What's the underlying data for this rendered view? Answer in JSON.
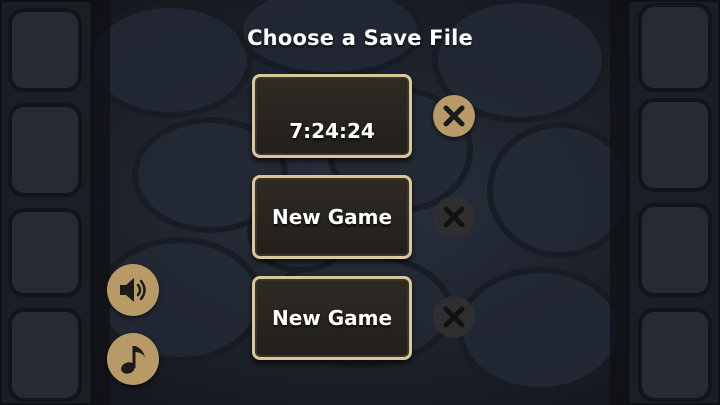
{
  "screen": {
    "title": "Choose a Save File"
  },
  "save_slots": [
    {
      "label": "7:24:24",
      "delete_icon": "x-circle-icon",
      "delete_enabled": true
    },
    {
      "label": "New Game",
      "delete_icon": "x-circle-icon",
      "delete_enabled": false
    },
    {
      "label": "New Game",
      "delete_icon": "x-circle-icon",
      "delete_enabled": false
    }
  ],
  "controls": {
    "sound_icon": "speaker-icon",
    "music_icon": "music-note-icon"
  },
  "colors": {
    "background": "#1b1f27",
    "slot_border": "#d9c79a",
    "slot_fill": "#2a2620",
    "button_tan": "#b79a66",
    "disabled_dark": "#2f2f31",
    "text": "#ffffff"
  }
}
